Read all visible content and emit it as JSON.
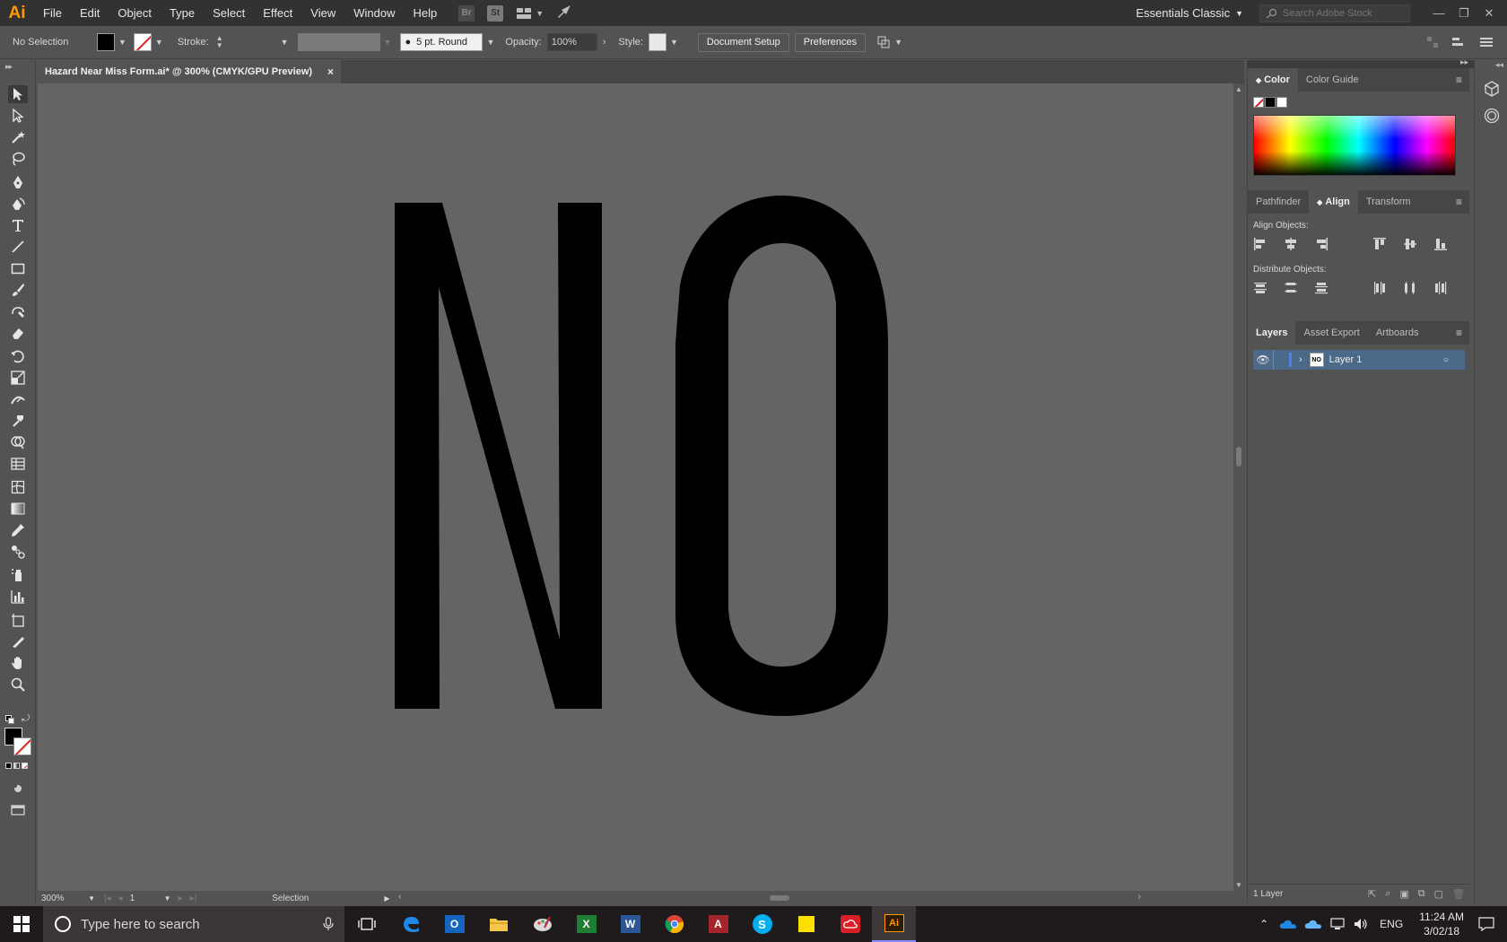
{
  "app": {
    "logo": "Ai",
    "menu": [
      "File",
      "Edit",
      "Object",
      "Type",
      "Select",
      "Effect",
      "View",
      "Window",
      "Help"
    ],
    "bridge_badge": "Br",
    "stock_badge": "St",
    "workspace": "Essentials Classic",
    "search_placeholder": "Search Adobe Stock"
  },
  "control_bar": {
    "selection_label": "No Selection",
    "stroke_label": "Stroke:",
    "brush": "5 pt. Round",
    "opacity_label": "Opacity:",
    "opacity_value": "100%",
    "style_label": "Style:",
    "document_setup": "Document Setup",
    "preferences": "Preferences"
  },
  "document": {
    "tab_title": "Hazard Near Miss Form.ai* @ 300% (CMYK/GPU Preview)",
    "close": "×",
    "artwork_text": "NO"
  },
  "status_bar": {
    "zoom": "300%",
    "artboard": "1",
    "tool": "Selection"
  },
  "panels": {
    "color": {
      "tabs": [
        "Color",
        "Color Guide"
      ]
    },
    "align": {
      "tabs": [
        "Pathfinder",
        "Align",
        "Transform"
      ],
      "align_objects": "Align Objects:",
      "distribute_objects": "Distribute Objects:"
    },
    "layers": {
      "tabs": [
        "Layers",
        "Asset Export",
        "Artboards"
      ],
      "items": [
        {
          "name": "Layer 1"
        }
      ],
      "count": "1 Layer"
    }
  },
  "taskbar": {
    "search_placeholder": "Type here to search",
    "language": "ENG",
    "time": "11:24 AM",
    "date": "3/02/18"
  },
  "colors": {
    "accent": "#ff9a00",
    "layer_highlight": "#4b6a8a",
    "canvas": "#646464"
  }
}
